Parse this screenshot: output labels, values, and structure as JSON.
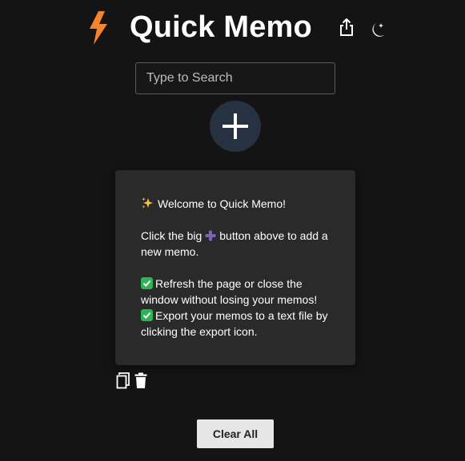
{
  "header": {
    "title": "Quick Memo",
    "logo_icon": "lightning-bolt-icon",
    "share_icon": "share-export-icon",
    "theme_icon": "moon-stars-icon"
  },
  "search": {
    "placeholder": "Type to Search",
    "value": ""
  },
  "add_button": {
    "icon": "plus-icon"
  },
  "memo": {
    "line1_icon": "sparkles-emoji",
    "line1": "Welcome to Quick Memo!",
    "line2_before": "Click the big",
    "line2_icon": "heavy-plus-emoji",
    "line2_after": "button above to add a new memo.",
    "line3_icon": "check-mark-button-emoji",
    "line3": "Refresh the page or close the window without losing your memos!",
    "line4_icon": "check-mark-button-emoji",
    "line4": "Export your memos to a text file by clicking the export icon."
  },
  "memo_actions": {
    "copy_icon": "copy-icon",
    "delete_icon": "trash-icon"
  },
  "footer": {
    "clear_label": "Clear All"
  },
  "colors": {
    "background": "#141414",
    "accent_bolt": "#f5842a",
    "add_button_bg": "#263242",
    "card_bg": "#2a2a2a",
    "check_green": "#2bb554",
    "plus_purple": "#7a63b8",
    "clear_button_bg": "#e6e6e6"
  }
}
